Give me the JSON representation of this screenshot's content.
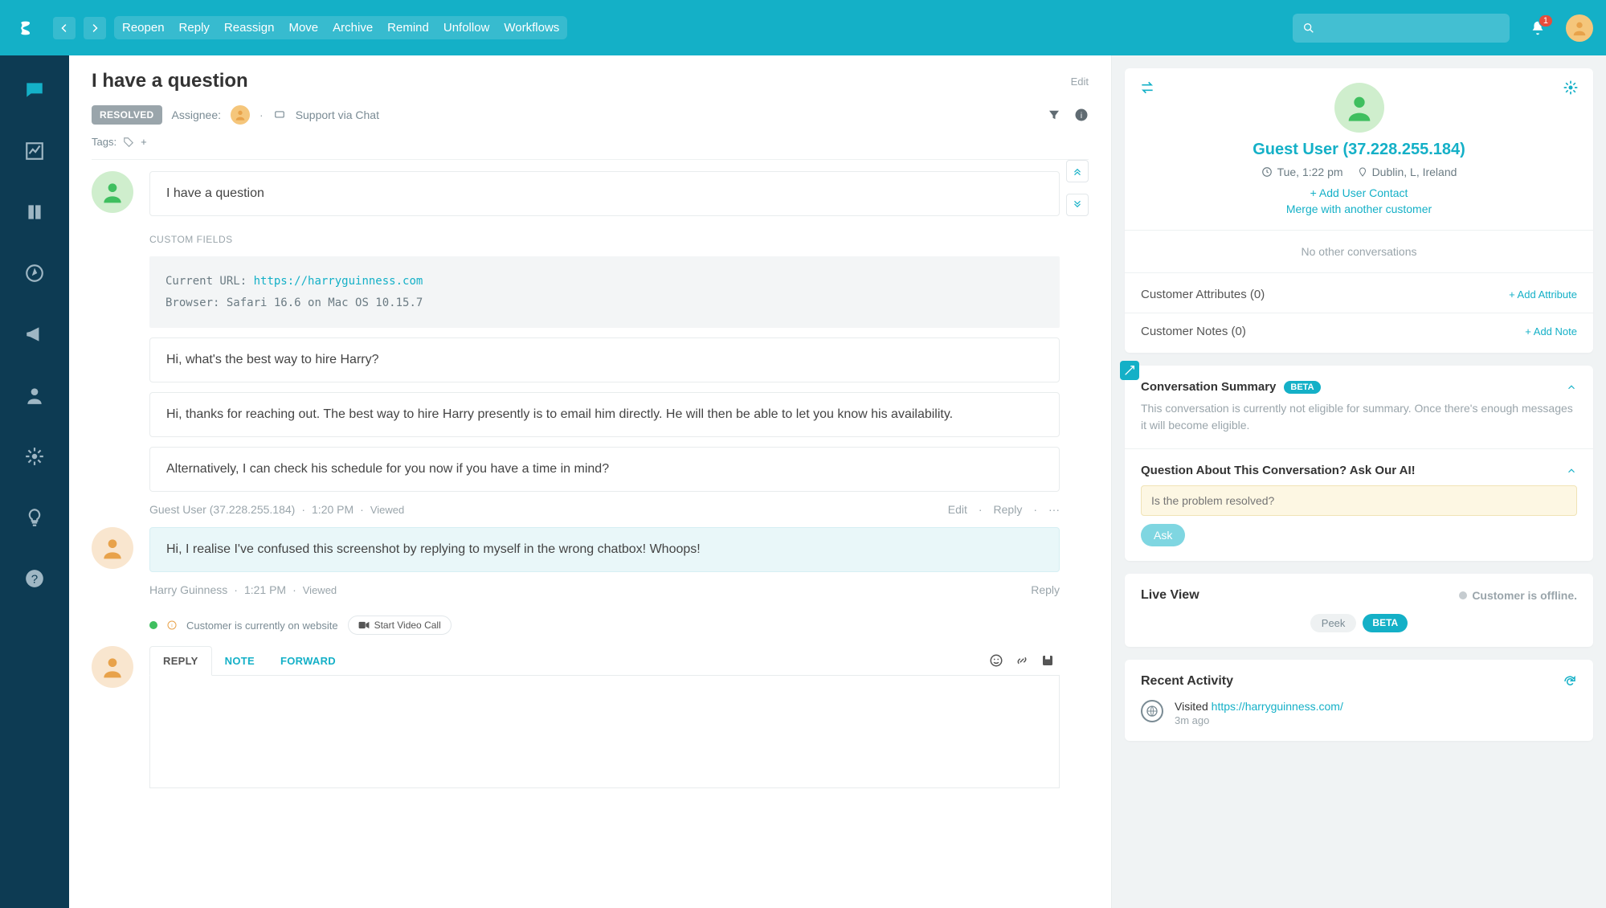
{
  "topbar": {
    "actions": [
      "Reopen",
      "Reply",
      "Reassign",
      "Move",
      "Archive",
      "Remind",
      "Unfollow",
      "Workflows"
    ],
    "notification_count": "1"
  },
  "thread": {
    "title": "I have a question",
    "edit_label": "Edit",
    "status_badge": "RESOLVED",
    "assignee_label": "Assignee:",
    "support_via": "Support via Chat",
    "tags_label": "Tags:",
    "add_tag": "+",
    "custom_fields_label": "CUSTOM FIELDS",
    "custom_fields": {
      "url_label": "Current URL:",
      "url_value": "https://harryguinness.com",
      "browser_label": "Browser:",
      "browser_value": "Safari 16.6 on Mac OS 10.15.7"
    },
    "messages": {
      "m0": "I have a question",
      "m1": "Hi, what's the best way to hire Harry?",
      "m2": "Hi, thanks for reaching out. The best way to hire Harry presently is to email him directly. He will then be able to let you know his availability.",
      "m3": "Alternatively, I can check his schedule for you now if you have a time in mind?",
      "m4": "Hi, I realise I've confused this screenshot by replying to myself in the wrong chatbox! Whoops!"
    },
    "byline1": {
      "author": "Guest User (37.228.255.184)",
      "time": "1:20 PM",
      "status": "Viewed",
      "edit": "Edit",
      "reply": "Reply"
    },
    "byline2": {
      "author": "Harry Guinness",
      "time": "1:21 PM",
      "status": "Viewed",
      "reply": "Reply"
    },
    "presence": {
      "text": "Customer is currently on website",
      "video_btn": "Start Video Call"
    },
    "composer_tabs": {
      "reply": "REPLY",
      "note": "NOTE",
      "forward": "FORWARD"
    }
  },
  "right": {
    "profile": {
      "name": "Guest User (37.228.255.184)",
      "time": "Tue, 1:22 pm",
      "location": "Dublin, L, Ireland",
      "add_contact": "+ Add User Contact",
      "merge": "Merge with another customer",
      "no_convos": "No other conversations",
      "attributes_label": "Customer Attributes (0)",
      "add_attribute": "+ Add Attribute",
      "notes_label": "Customer Notes (0)",
      "add_note": "+ Add Note"
    },
    "ai": {
      "summary_title": "Conversation Summary",
      "beta": "BETA",
      "summary_desc": "This conversation is currently not eligible for summary. Once there's enough messages it will become eligible.",
      "question_title": "Question About This Conversation? Ask Our AI!",
      "placeholder": "Is the problem resolved?",
      "ask_btn": "Ask"
    },
    "live": {
      "title": "Live View",
      "offline": "Customer is offline.",
      "peek": "Peek",
      "beta": "BETA"
    },
    "activity": {
      "title": "Recent Activity",
      "visited_label": "Visited",
      "visited_url": "https://harryguinness.com/",
      "ago": "3m ago"
    }
  }
}
